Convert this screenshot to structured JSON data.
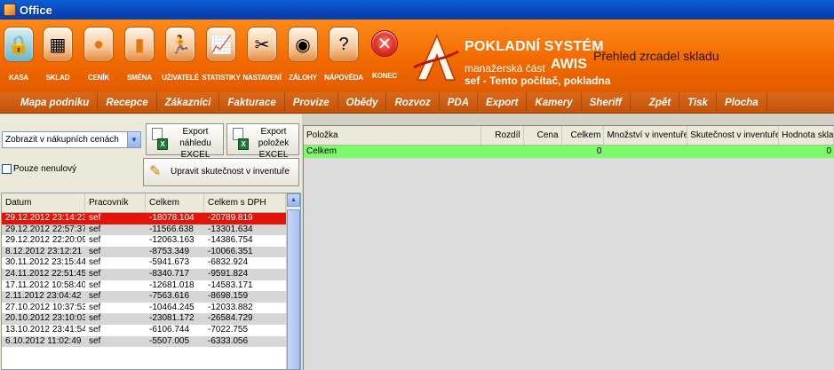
{
  "window": {
    "title": "Office"
  },
  "toolbar": [
    {
      "label": "KASA",
      "icon": "cash-register-icon",
      "glyph": "🔒"
    },
    {
      "label": "SKLAD",
      "icon": "warehouse-box-icon",
      "glyph": "▦"
    },
    {
      "label": "CENÍK",
      "icon": "price-list-icon",
      "glyph": "●"
    },
    {
      "label": "SMĚNA",
      "icon": "shift-icon",
      "glyph": "▮"
    },
    {
      "label": "UŽIVATELÉ",
      "icon": "users-icon",
      "glyph": "🏃"
    },
    {
      "label": "STATISTIKY",
      "icon": "statistics-chart-icon",
      "glyph": "📈"
    },
    {
      "label": "NASTAVENÍ",
      "icon": "settings-tools-icon",
      "glyph": "✂"
    },
    {
      "label": "ZÁLOHY",
      "icon": "backup-disc-icon",
      "glyph": "◉"
    },
    {
      "label": "NÁPOVĚDA",
      "icon": "help-globe-icon",
      "glyph": "?"
    },
    {
      "label": "KONEC",
      "icon": "exit-icon",
      "glyph": "✕"
    }
  ],
  "brand": {
    "line1": "POKLADNÍ SYSTÉM",
    "line2": "manažerská část",
    "line3": "AWIS",
    "line4": "sef  -  Tento počítač, pokladna"
  },
  "view_title": "Přehled zrcadel skladu",
  "menu": [
    "Mapa podniku",
    "Recepce",
    "Zákazníci",
    "Fakturace",
    "Provize",
    "Obědy",
    "Rozvoz",
    "PDA",
    "Export",
    "Kamery",
    "Sheriff",
    "Zpět",
    "Tisk",
    "Plocha"
  ],
  "left": {
    "price_select": "Zobrazit v nákupních cenách",
    "nonzero_checkbox": "Pouze nenulový",
    "export_preview": "Export náhledu EXCEL",
    "export_items": "Export položek EXCEL",
    "edit_inventory": "Upravit skutečnost v inventuře",
    "columns": [
      "Datum",
      "Pracovník",
      "Celkem",
      "Celkem s DPH"
    ],
    "rows": [
      [
        "29.12.2012 23:14:23",
        "sef",
        "-18078.104",
        "-20789.819"
      ],
      [
        "29.12.2012 22:57:37",
        "sef",
        "-11566.638",
        "-13301.634"
      ],
      [
        "29.12.2012 22:20:09",
        "sef",
        "-12063.163",
        "-14386.754"
      ],
      [
        "8.12.2012 23:12:21",
        "sef",
        "-8753.349",
        "-10066.351"
      ],
      [
        "30.11.2012 23:15:44",
        "sef",
        "-5941.673",
        "-6832.924"
      ],
      [
        "24.11.2012 22:51:45",
        "sef",
        "-8340.717",
        "-9591.824"
      ],
      [
        "17.11.2012 10:58:40",
        "sef",
        "-12681.018",
        "-14583.171"
      ],
      [
        "2.11.2012 23:04:42",
        "sef",
        "-7563.616",
        "-8698.159"
      ],
      [
        "27.10.2012 10:37:53",
        "sef",
        "-10464.245",
        "-12033.882"
      ],
      [
        "20.10.2012 23:10:03",
        "sef",
        "-23081.172",
        "-26584.729"
      ],
      [
        "13.10.2012 23:41:54",
        "sef",
        "-6106.744",
        "-7022.755"
      ],
      [
        "6.10.2012 11:02:49",
        "sef",
        "-5507.005",
        "-6333.056"
      ]
    ]
  },
  "right": {
    "columns": [
      "Položka",
      "Rozdíl",
      "Cena",
      "Celkem",
      "Množství v inventuře",
      "Skutečnost v inventuře",
      "Hodnota skladu"
    ],
    "total_row": {
      "label": "Celkem",
      "total": "0",
      "stock_value": "0"
    }
  },
  "colors": {
    "header_orange": "#f26a00",
    "selected_row": "#e3150a",
    "total_row": "#7dfa6a"
  }
}
